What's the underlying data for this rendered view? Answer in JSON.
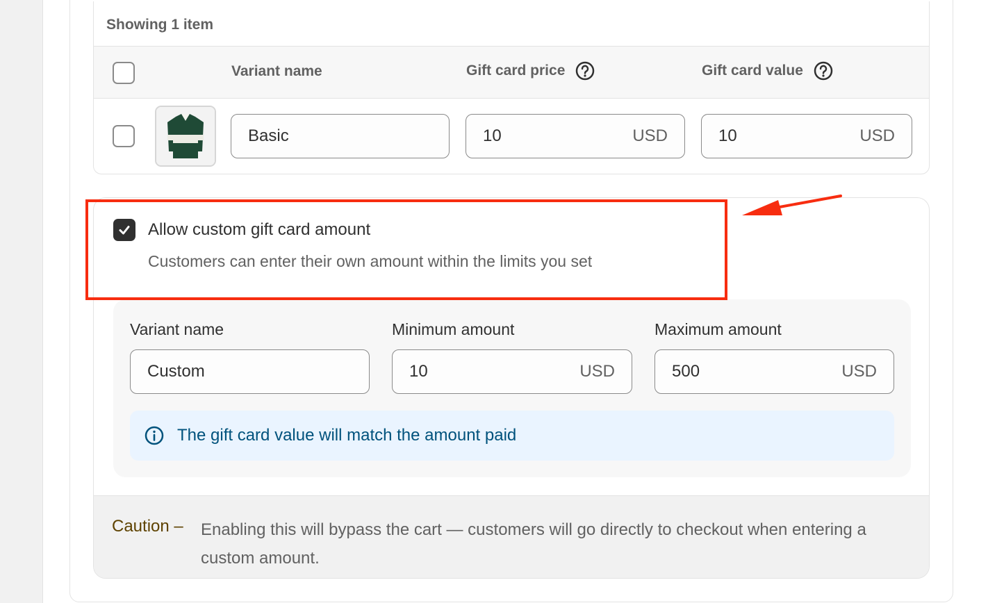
{
  "table": {
    "summary": "Showing 1 item",
    "columns": {
      "variant_name": "Variant name",
      "gift_card_price": "Gift card price",
      "gift_card_value": "Gift card value"
    },
    "rows": [
      {
        "variant_name": "Basic",
        "price": "10",
        "price_currency": "USD",
        "value": "10",
        "value_currency": "USD"
      }
    ]
  },
  "custom_amount": {
    "checked": true,
    "title": "Allow custom gift card amount",
    "description": "Customers can enter their own amount within the limits you set",
    "labels": {
      "variant_name": "Variant name",
      "minimum_amount": "Minimum amount",
      "maximum_amount": "Maximum amount"
    },
    "variant_name": "Custom",
    "minimum": "10",
    "minimum_currency": "USD",
    "maximum": "500",
    "maximum_currency": "USD",
    "info_banner": "The gift card value will match the amount paid",
    "caution_label": "Caution –",
    "caution_text": "Enabling this will bypass the cart — customers will go directly to checkout when entering a custom amount."
  },
  "colors": {
    "annotation": "#f72d10",
    "info_bg": "#eaf4ff",
    "info_text": "#00527c",
    "caution_label": "#5e4200"
  },
  "icons": [
    "question-circle-icon",
    "checkmark-icon",
    "info-icon",
    "product-thumbnail"
  ]
}
